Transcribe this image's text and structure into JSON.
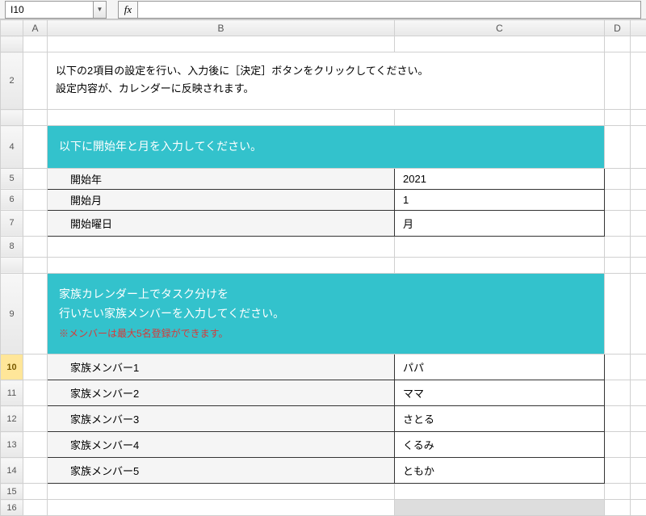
{
  "active_cell": "I10",
  "formula_value": "",
  "columns": [
    "A",
    "B",
    "C",
    "D",
    ""
  ],
  "row_numbers": [
    "",
    "2",
    "",
    "4",
    "5",
    "6",
    "7",
    "8",
    "",
    "9",
    "10",
    "11",
    "12",
    "13",
    "14",
    "15",
    "16"
  ],
  "selected_row": "10",
  "instructions": {
    "line1": "以下の2項目の設定を行い、入力後に［決定］ボタンをクリックしてください。",
    "line2": "設定内容が、カレンダーに反映されます。"
  },
  "section1": {
    "title": "以下に開始年と月を入力してください。",
    "rows": [
      {
        "label": "開始年",
        "value": "2021"
      },
      {
        "label": "開始月",
        "value": "1"
      },
      {
        "label": "開始曜日",
        "value": "月"
      }
    ]
  },
  "section2": {
    "title_line1": "家族カレンダー上でタスク分けを",
    "title_line2": "行いたい家族メンバーを入力してください。",
    "note": "※メンバーは最大5名登録ができます。",
    "rows": [
      {
        "label": "家族メンバー1",
        "value": "パパ"
      },
      {
        "label": "家族メンバー2",
        "value": "ママ"
      },
      {
        "label": "家族メンバー3",
        "value": "さとる"
      },
      {
        "label": "家族メンバー4",
        "value": "くるみ"
      },
      {
        "label": "家族メンバー5",
        "value": "ともか"
      }
    ]
  }
}
